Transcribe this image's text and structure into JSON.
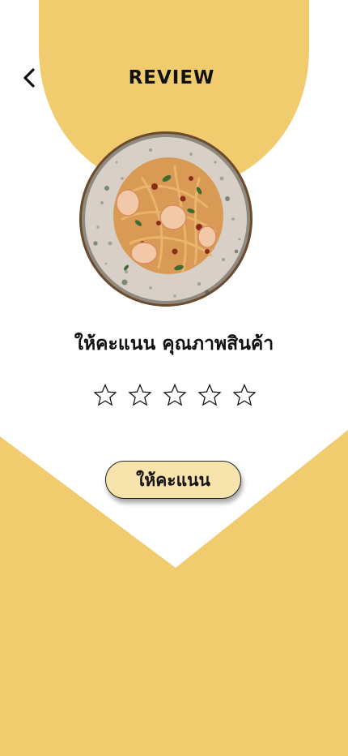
{
  "header": {
    "title": "REVIEW",
    "back_icon": "chevron-left-icon"
  },
  "dish": {
    "image": "shrimp-spaghetti-plate"
  },
  "rating": {
    "heading": "ให้คะแนน คุณภาพสินค้า",
    "max_stars": 5,
    "selected": 0,
    "star_icon": "star-outline-icon"
  },
  "submit": {
    "label": "ให้คะแนน"
  },
  "colors": {
    "accent": "#f0cc6e",
    "button_bg": "#f7e3ac",
    "text": "#111111",
    "background": "#ffffff"
  }
}
